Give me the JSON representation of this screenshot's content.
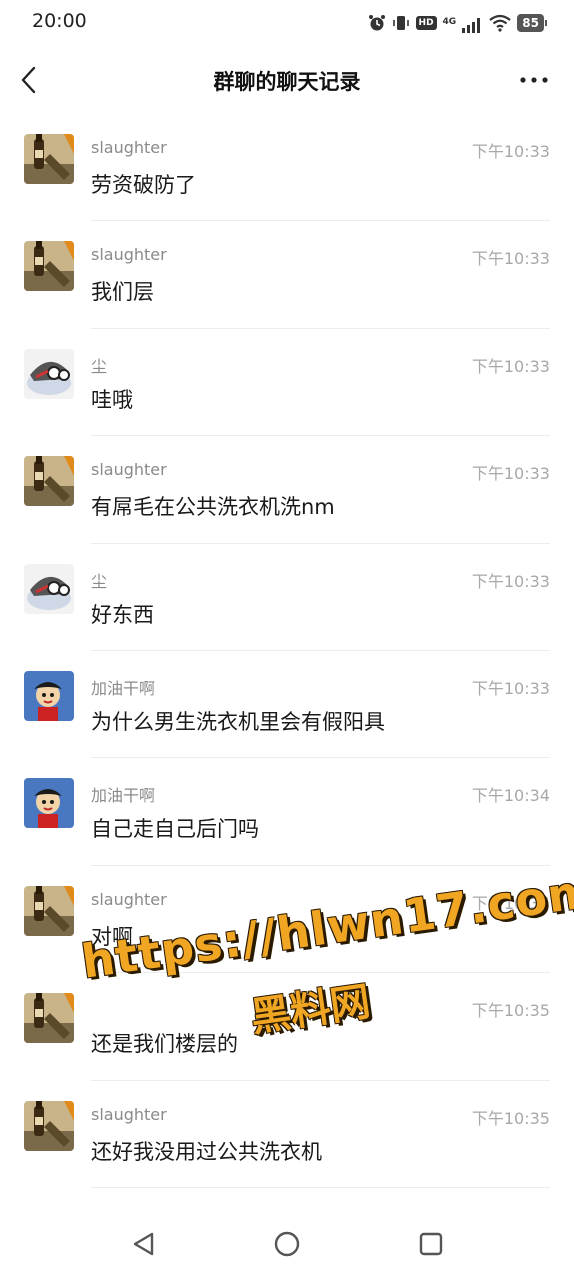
{
  "status": {
    "time": "20:00",
    "network": "4G",
    "hd": "HD",
    "battery": "85"
  },
  "header": {
    "title": "群聊的聊天记录"
  },
  "messages": [
    {
      "sender": "slaughter",
      "time": "下午10:33",
      "text": "劳资破防了",
      "avatar": "beer-avatar"
    },
    {
      "sender": "slaughter",
      "time": "下午10:33",
      "text": "我们层",
      "avatar": "beer-avatar"
    },
    {
      "sender": "尘",
      "time": "下午10:33",
      "text": "哇哦",
      "avatar": "cartoon-avatar"
    },
    {
      "sender": "slaughter",
      "time": "下午10:33",
      "text": "有屌毛在公共洗衣机洗nm",
      "avatar": "beer-avatar"
    },
    {
      "sender": "尘",
      "time": "下午10:33",
      "text": "好东西",
      "avatar": "cartoon-avatar"
    },
    {
      "sender": "加油干啊",
      "time": "下午10:33",
      "text": "为什么男生洗衣机里会有假阳具",
      "avatar": "luffy-avatar"
    },
    {
      "sender": "加油干啊",
      "time": "下午10:34",
      "text": "自己走自己后门吗",
      "avatar": "luffy-avatar"
    },
    {
      "sender": "slaughter",
      "time": "下午10:35",
      "text": "对啊",
      "avatar": "beer-avatar"
    },
    {
      "sender": "",
      "time": "下午10:35",
      "text": "还是我们楼层的",
      "avatar": "beer-avatar"
    },
    {
      "sender": "slaughter",
      "time": "下午10:35",
      "text": "还好我没用过公共洗衣机",
      "avatar": "beer-avatar"
    }
  ],
  "watermark": {
    "line1": "https://hlwn17.com",
    "line2": "黑料网"
  }
}
